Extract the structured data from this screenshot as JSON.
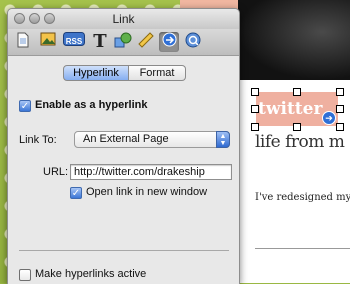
{
  "window": {
    "title": "Link",
    "toolbar_icons": [
      "document-icon",
      "image-icon",
      "rss-icon",
      "text-icon",
      "shapes-icon",
      "ruler-icon",
      "link-icon",
      "quicktime-icon"
    ],
    "selected_toolbar_icon": "link-icon",
    "rss_label": "RSS",
    "text_label": "T"
  },
  "tabs": {
    "hyperlink": "Hyperlink",
    "format": "Format",
    "active": "Hyperlink"
  },
  "enable_hyperlink": {
    "label": "Enable as a hyperlink",
    "checked": true
  },
  "link_to": {
    "label": "Link To:",
    "value": "An External Page"
  },
  "url": {
    "label": "URL:",
    "value": "http://twitter.com/drakeship"
  },
  "open_new_window": {
    "label": "Open link in new window",
    "checked": true
  },
  "make_active": {
    "label": "Make hyperlinks active",
    "checked": false
  },
  "page": {
    "badge_text": "twitter",
    "heading": "life from m",
    "body_text": "I've redesigned my"
  },
  "colors": {
    "accent": "#3b76d6",
    "badge": "#efb0a0"
  }
}
